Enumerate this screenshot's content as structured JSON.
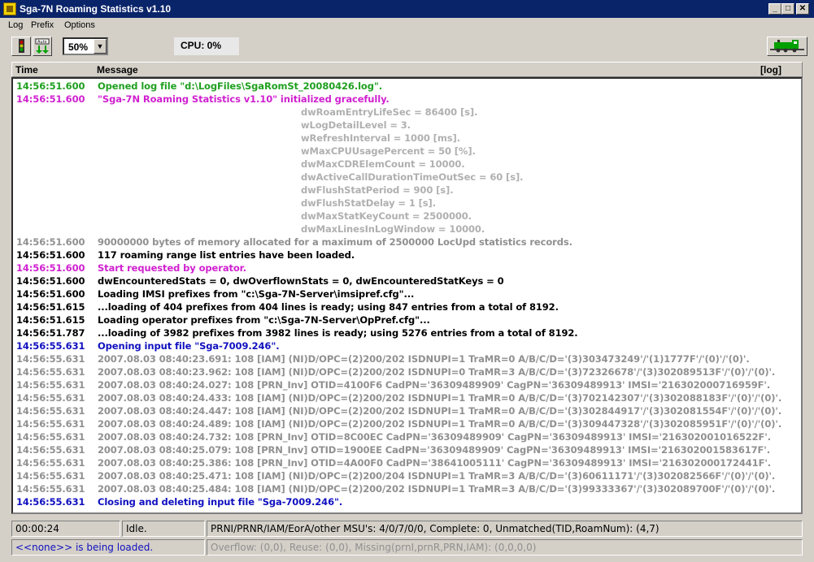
{
  "window": {
    "title": "Sga-7N Roaming Statistics  v1.10",
    "controls": [
      "_",
      "□",
      "✕"
    ]
  },
  "menu": [
    "Log",
    "Prefix",
    "Options"
  ],
  "toolbar": {
    "zoom_value": "50%",
    "cpu_label": "CPU:  0%"
  },
  "log": {
    "headers": {
      "time": "Time",
      "message": "Message",
      "log": "[log]"
    },
    "rows": [
      {
        "t": "14:56:51.600",
        "m": "Opened log file \"d:\\LogFiles\\SgaRomSt_20080426.log\".",
        "c": "green"
      },
      {
        "t": "14:56:51.600",
        "m": "\"Sga-7N Roaming Statistics  v1.10\" initialized gracefully.",
        "c": "magenta"
      },
      {
        "t": "",
        "m": "dwRoamEntryLifeSec = 86400 [s].",
        "c": "lgray",
        "ind": true
      },
      {
        "t": "",
        "m": "wLogDetailLevel = 3.",
        "c": "lgray",
        "ind": true
      },
      {
        "t": "",
        "m": "wRefreshInterval = 1000 [ms].",
        "c": "lgray",
        "ind": true
      },
      {
        "t": "",
        "m": "wMaxCPUUsagePercent = 50 [%].",
        "c": "lgray",
        "ind": true
      },
      {
        "t": "",
        "m": "dwMaxCDRElemCount = 10000.",
        "c": "lgray",
        "ind": true
      },
      {
        "t": "",
        "m": "dwActiveCallDurationTimeOutSec = 60 [s].",
        "c": "lgray",
        "ind": true
      },
      {
        "t": "",
        "m": "dwFlushStatPeriod = 900 [s].",
        "c": "lgray",
        "ind": true
      },
      {
        "t": "",
        "m": "dwFlushStatDelay = 1 [s].",
        "c": "lgray",
        "ind": true
      },
      {
        "t": "",
        "m": "dwMaxStatKeyCount = 2500000.",
        "c": "lgray",
        "ind": true
      },
      {
        "t": "",
        "m": "dwMaxLinesInLogWindow = 10000.",
        "c": "lgray",
        "ind": true
      },
      {
        "t": "14:56:51.600",
        "m": "90000000 bytes of memory allocated for a maximum of 2500000 LocUpd statistics records.",
        "c": "gray"
      },
      {
        "t": "14:56:51.600",
        "m": "117 roaming range list entries have been loaded.",
        "c": "black"
      },
      {
        "t": "14:56:51.600",
        "m": "Start requested by operator.",
        "c": "magenta"
      },
      {
        "t": "14:56:51.600",
        "m": "dwEncounteredStats = 0, dwOverflownStats = 0, dwEncounteredStatKeys = 0",
        "c": "black"
      },
      {
        "t": "14:56:51.600",
        "m": "Loading IMSI prefixes from \"c:\\Sga-7N-Server\\imsipref.cfg\"...",
        "c": "black"
      },
      {
        "t": "14:56:51.615",
        "m": "...loading of 404 prefixes from 404 lines is ready; using 847 entries from a total of 8192.",
        "c": "black"
      },
      {
        "t": "14:56:51.615",
        "m": "Loading operator prefixes from \"c:\\Sga-7N-Server\\OpPref.cfg\"...",
        "c": "black"
      },
      {
        "t": "14:56:51.787",
        "m": "...loading of 3982 prefixes from 3982 lines is ready; using 5276 entries from a total of 8192.",
        "c": "black"
      },
      {
        "t": "14:56:55.631",
        "m": "Opening input file \"Sga-7009.246\".",
        "c": "blue"
      },
      {
        "t": "14:56:55.631",
        "m": "2007.08.03 08:40:23.691:  108  [IAM]  (NI)D/OPC=(2)200/202  ISDNUPI=1  TraMR=0  A/B/C/D='(3)303473249'/'(1)1777F'/'(0)'/'(0)'.",
        "c": "gray"
      },
      {
        "t": "14:56:55.631",
        "m": "2007.08.03 08:40:23.962:  108  [IAM]  (NI)D/OPC=(2)200/202  ISDNUPI=0  TraMR=3  A/B/C/D='(3)72326678'/'(3)302089513F'/'(0)'/'(0)'.",
        "c": "gray"
      },
      {
        "t": "14:56:55.631",
        "m": "2007.08.03 08:40:24.027:  108  [PRN_Inv]  OTID=4100F6  CadPN='36309489909'  CagPN='36309489913'  IMSI='216302000716959F'.",
        "c": "gray"
      },
      {
        "t": "14:56:55.631",
        "m": "2007.08.03 08:40:24.433:  108  [IAM]  (NI)D/OPC=(2)200/202  ISDNUPI=1  TraMR=0  A/B/C/D='(3)702142307'/'(3)302088183F'/'(0)'/'(0)'.",
        "c": "gray"
      },
      {
        "t": "14:56:55.631",
        "m": "2007.08.03 08:40:24.447:  108  [IAM]  (NI)D/OPC=(2)200/202  ISDNUPI=1  TraMR=0  A/B/C/D='(3)302844917'/'(3)302081554F'/'(0)'/'(0)'.",
        "c": "gray"
      },
      {
        "t": "14:56:55.631",
        "m": "2007.08.03 08:40:24.489:  108  [IAM]  (NI)D/OPC=(2)200/202  ISDNUPI=1  TraMR=0  A/B/C/D='(3)309447328'/'(3)302085951F'/'(0)'/'(0)'.",
        "c": "gray"
      },
      {
        "t": "14:56:55.631",
        "m": "2007.08.03 08:40:24.732:  108  [PRN_Inv]  OTID=8C00EC  CadPN='36309489909'  CagPN='36309489913'  IMSI='216302001016522F'.",
        "c": "gray"
      },
      {
        "t": "14:56:55.631",
        "m": "2007.08.03 08:40:25.079:  108  [PRN_Inv]  OTID=1900EE  CadPN='36309489909'  CagPN='36309489913'  IMSI='216302001583617F'.",
        "c": "gray"
      },
      {
        "t": "14:56:55.631",
        "m": "2007.08.03 08:40:25.386:  108  [PRN_Inv]  OTID=4A00F0  CadPN='38641005111'  CagPN='36309489913'  IMSI='216302000172441F'.",
        "c": "gray"
      },
      {
        "t": "14:56:55.631",
        "m": "2007.08.03 08:40:25.471:  108  [IAM]  (NI)D/OPC=(2)200/204  ISDNUPI=1  TraMR=3  A/B/C/D='(3)60611171'/'(3)302082566F'/'(0)'/'(0)'.",
        "c": "gray"
      },
      {
        "t": "14:56:55.631",
        "m": "2007.08.03 08:40:25.484:  108  [IAM]  (NI)D/OPC=(2)200/202  ISDNUPI=1  TraMR=3  A/B/C/D='(3)99333367'/'(3)302089700F'/'(0)'/'(0)'.",
        "c": "gray"
      },
      {
        "t": "14:56:55.631",
        "m": "Closing and deleting input file \"Sga-7009.246\".",
        "c": "blue"
      }
    ]
  },
  "status": {
    "elapsed": "00:00:24",
    "state": "Idle.",
    "counters": "PRNI/PRNR/IAM/EorA/other MSU's: 4/0/7/0/0,  Complete: 0,  Unmatched(TID,RoamNum): (4,7)",
    "loading": "<<none>> is being loaded.",
    "overflow": "Overflow: (0,0), Reuse: (0,0), Missing(prnI,prnR,PRN,IAM): (0,0,0,0)"
  }
}
